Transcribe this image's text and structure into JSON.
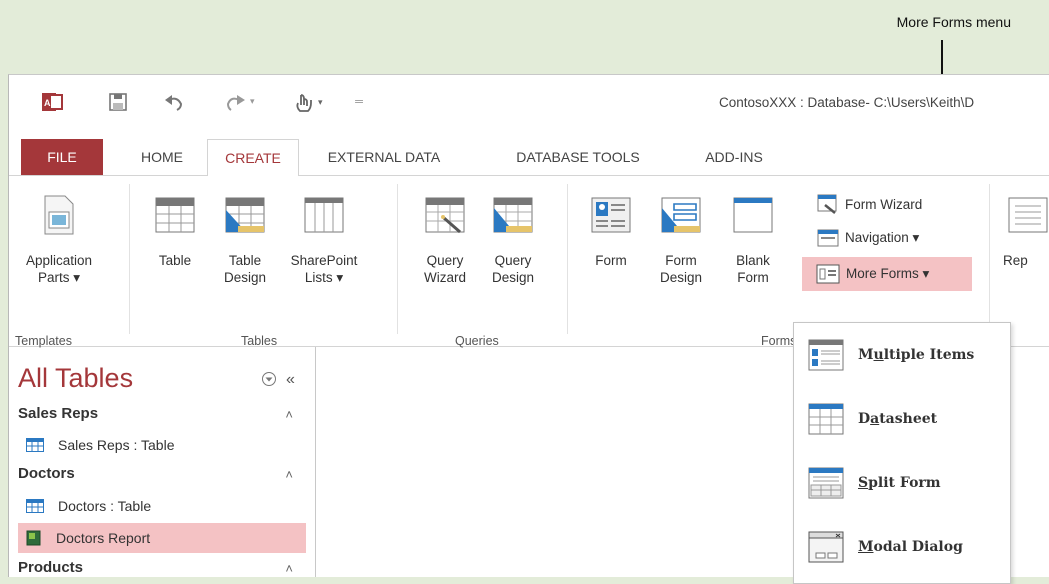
{
  "callout": {
    "text": "More Forms menu"
  },
  "window": {
    "title": "ContosoXXX : Database- C:\\Users\\Keith\\D"
  },
  "tabs": {
    "file": "FILE",
    "home": "HOME",
    "create": "CREATE",
    "external_data": "EXTERNAL DATA",
    "database_tools": "DATABASE TOOLS",
    "add_ins": "ADD-INS"
  },
  "ribbon": {
    "templates": {
      "group_label": "Templates",
      "application_parts": [
        "Application",
        "Parts ▾"
      ]
    },
    "tables": {
      "group_label": "Tables",
      "table": "Table",
      "table_design": [
        "Table",
        "Design"
      ],
      "sharepoint_lists": [
        "SharePoint",
        "Lists ▾"
      ]
    },
    "queries": {
      "group_label": "Queries",
      "query_wizard": [
        "Query",
        "Wizard"
      ],
      "query_design": [
        "Query",
        "Design"
      ]
    },
    "forms": {
      "group_label": "Forms",
      "form": "Form",
      "form_design": [
        "Form",
        "Design"
      ],
      "blank_form": [
        "Blank",
        "Form"
      ],
      "form_wizard": "Form Wizard",
      "navigation": "Navigation ▾",
      "more_forms": "More Forms ▾"
    },
    "reports": {
      "report_partial": "Rep"
    }
  },
  "nav_pane": {
    "title": "All Tables",
    "groups": [
      {
        "header": "Sales Reps",
        "items": [
          "Sales Reps : Table"
        ]
      },
      {
        "header": "Doctors",
        "items": [
          "Doctors : Table",
          "Doctors Report"
        ]
      },
      {
        "header": "Products",
        "items": []
      }
    ]
  },
  "more_forms_menu": {
    "items": [
      {
        "pre": "M",
        "u": "u",
        "post": "ltiple Items"
      },
      {
        "pre": "D",
        "u": "a",
        "post": "tasheet"
      },
      {
        "pre": "",
        "u": "S",
        "post": "plit Form"
      },
      {
        "pre": "",
        "u": "M",
        "post": "odal Dialog"
      }
    ]
  },
  "colors": {
    "accent": "#a4373a",
    "highlight": "#f4c2c4",
    "background": "#e3ecd9"
  }
}
